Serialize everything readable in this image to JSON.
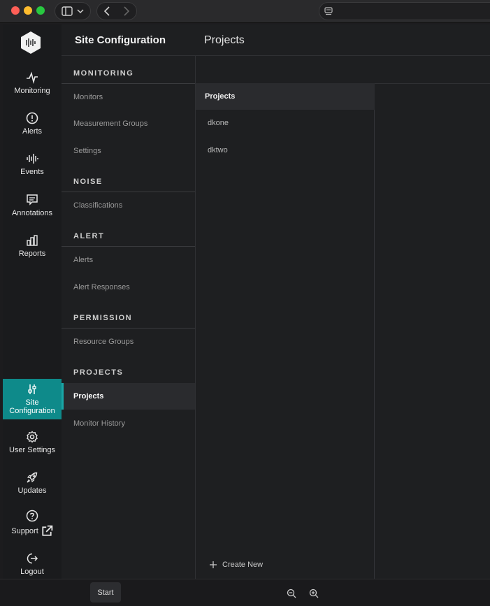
{
  "header": {
    "title": "Site Configuration"
  },
  "rail": {
    "items": [
      {
        "label": "Monitoring",
        "icon": "activity-icon"
      },
      {
        "label": "Alerts",
        "icon": "alert-circle-icon"
      },
      {
        "label": "Events",
        "icon": "waveform-icon"
      },
      {
        "label": "Annotations",
        "icon": "annotation-icon"
      },
      {
        "label": "Reports",
        "icon": "bar-chart-icon"
      }
    ],
    "bottom_items": [
      {
        "label": "Site Configuration",
        "label_line1": "Site",
        "label_line2": "Configuration",
        "icon": "sliders-icon",
        "active": true
      },
      {
        "label": "User Settings",
        "icon": "gear-icon"
      },
      {
        "label": "Updates",
        "icon": "rocket-icon"
      },
      {
        "label": "Support",
        "icon": "help-circle-icon"
      },
      {
        "label": "Logout",
        "icon": "logout-icon"
      }
    ]
  },
  "settings_nav": {
    "monitoring": {
      "heading": "MONITORING",
      "links": [
        "Monitors",
        "Measurement Groups",
        "Settings"
      ]
    },
    "noise": {
      "heading": "NOISE",
      "links": [
        "Classifications"
      ]
    },
    "alert": {
      "heading": "ALERT",
      "links": [
        "Alerts",
        "Alert Responses"
      ]
    },
    "permission": {
      "heading": "PERMISSION",
      "links": [
        "Resource Groups"
      ]
    },
    "projects": {
      "heading": "PROJECTS",
      "links": [
        "Projects",
        "Monitor History"
      ]
    }
  },
  "projects": {
    "title": "Projects",
    "list_heading": "Projects",
    "items": [
      "dkone",
      "dktwo"
    ],
    "create_label": "Create New"
  },
  "bottombar": {
    "start_label": "Start"
  },
  "colors": {
    "accent": "#0e8a8a",
    "background": "#1e1f21"
  }
}
